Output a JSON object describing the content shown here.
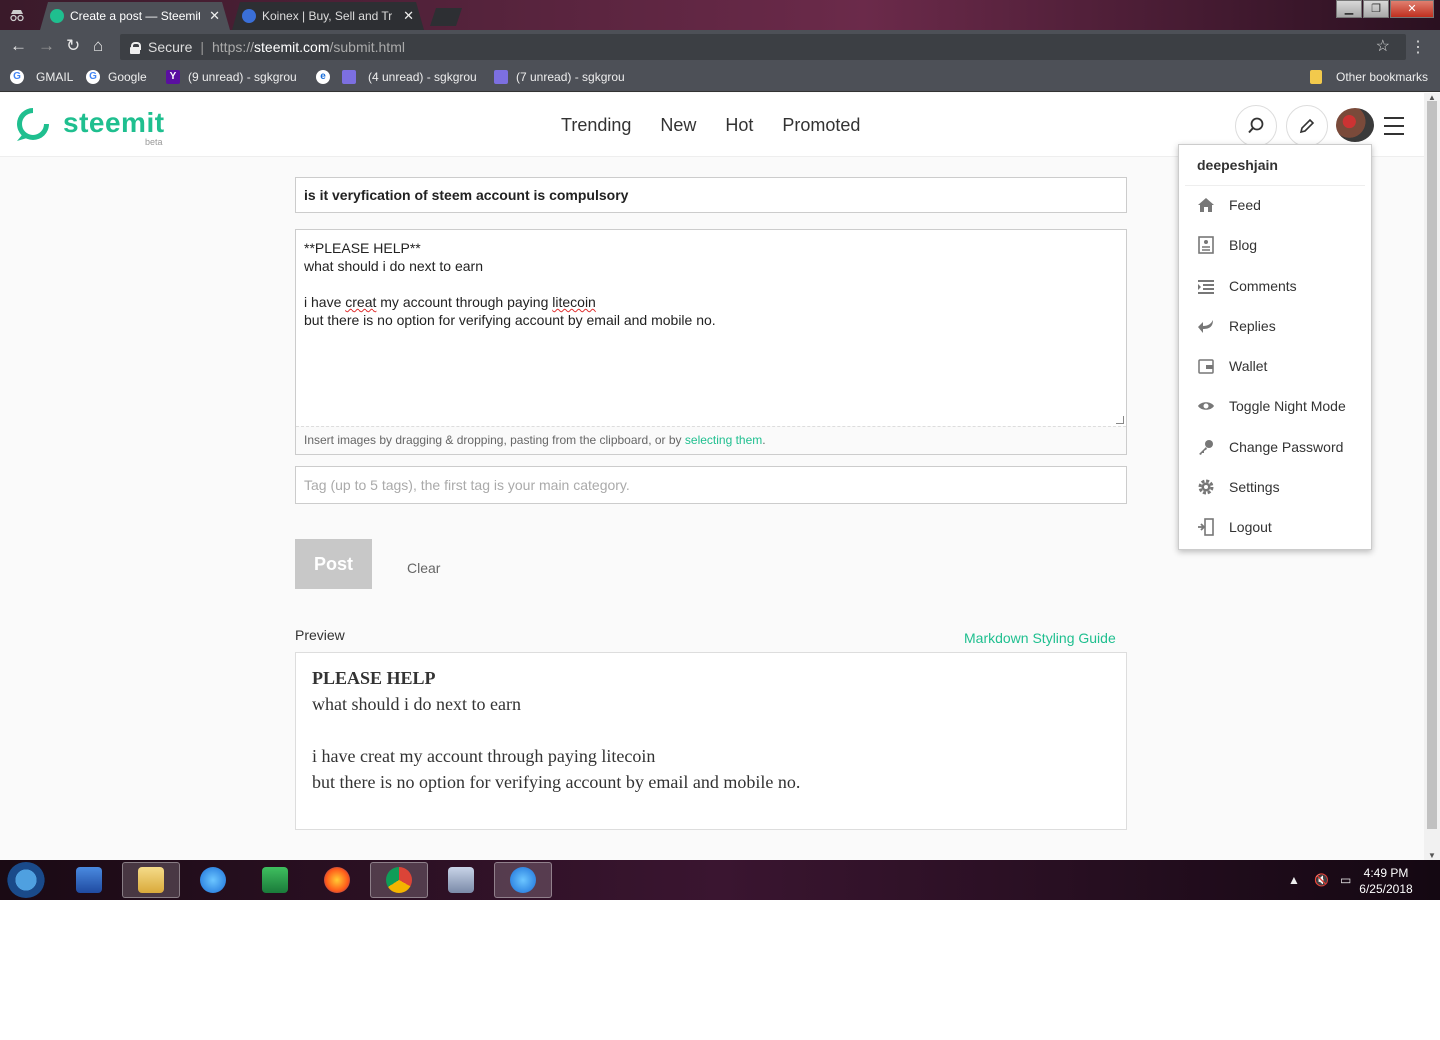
{
  "browser": {
    "tabs": [
      {
        "title": "Create a post — Steemit",
        "active": true
      },
      {
        "title": "Koinex | Buy, Sell and Tra",
        "active": false
      }
    ],
    "close_glyph": "✕",
    "address": {
      "secure_label": "Secure",
      "url_scheme": "https://",
      "url_host": "steemit.com",
      "url_path": "/submit.html"
    },
    "bookmarks": [
      {
        "label": "GMAIL",
        "icon": "google-icon"
      },
      {
        "label": "Google",
        "icon": "google-icon"
      },
      {
        "label": "(9 unread) - sgkgrou",
        "icon": "yahoo-icon"
      },
      {
        "label": "(4 unread) - sgkgrou",
        "icon": "mail-icon"
      },
      {
        "label": "(7 unread) - sgkgrou",
        "icon": "mail-icon"
      }
    ],
    "other_bookmarks": "Other bookmarks"
  },
  "site": {
    "logo_text": "steemit",
    "logo_sub": "beta",
    "nav": [
      "Trending",
      "New",
      "Hot",
      "Promoted"
    ],
    "accent": "#1fbf8f"
  },
  "editor": {
    "title_value": "is it veryfication of steem account is compulsory",
    "body_lines": {
      "l1": "**PLEASE HELP**",
      "l2": "what should i do next to earn",
      "l3_a": "i have ",
      "l3_b": "creat",
      "l3_c": " my account through paying ",
      "l3_d": "litecoin",
      "l4": "but there is no option for verifying account by email and mobile no."
    },
    "image_hint": "Insert images by dragging & dropping, pasting from the clipboard, or by ",
    "image_hint_link": "selecting them",
    "image_hint_end": ".",
    "tag_placeholder": "Tag (up to 5 tags), the first tag is your main category.",
    "post_label": "Post",
    "clear_label": "Clear",
    "preview_label": "Preview",
    "markdown_guide": "Markdown Styling Guide",
    "preview": {
      "heading": "PLEASE HELP",
      "line2": "what should i do next to earn",
      "line3": "i have creat my account through paying litecoin",
      "line4": "but there is no option for verifying account by email and mobile no."
    }
  },
  "user_menu": {
    "username": "deepeshjain",
    "items": [
      {
        "label": "Feed",
        "icon": "home-icon"
      },
      {
        "label": "Blog",
        "icon": "blog-icon"
      },
      {
        "label": "Comments",
        "icon": "comments-icon"
      },
      {
        "label": "Replies",
        "icon": "reply-icon"
      },
      {
        "label": "Wallet",
        "icon": "wallet-icon"
      },
      {
        "label": "Toggle Night Mode",
        "icon": "eye-icon"
      },
      {
        "label": "Change Password",
        "icon": "key-icon"
      },
      {
        "label": "Settings",
        "icon": "gear-icon"
      },
      {
        "label": "Logout",
        "icon": "logout-icon"
      }
    ]
  },
  "taskbar": {
    "time": "4:49 PM",
    "date": "6/25/2018"
  }
}
